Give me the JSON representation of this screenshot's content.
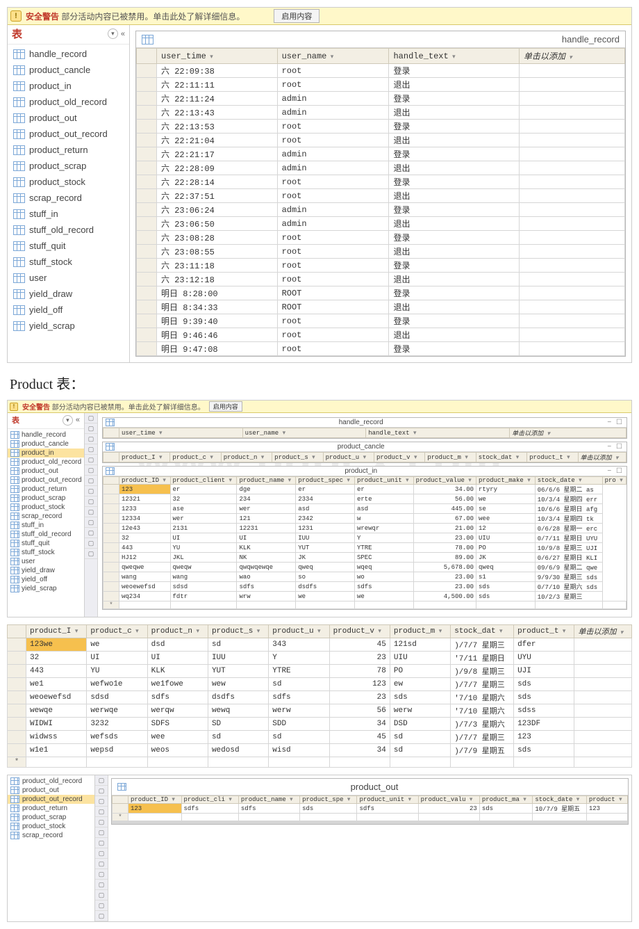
{
  "watermark": "www.bdocx.com",
  "msgbar": {
    "strong": "安全警告",
    "rest": "部分活动内容已被禁用。单击此处了解详细信息。",
    "btn": "启用内容"
  },
  "pane": {
    "title": "表",
    "chevrons": "«",
    "circle": "▾"
  },
  "nav_items": [
    "handle_record",
    "product_cancle",
    "product_in",
    "product_old_record",
    "product_out",
    "product_out_record",
    "product_return",
    "product_scrap",
    "product_stock",
    "scrap_record",
    "stuff_in",
    "stuff_old_record",
    "stuff_quit",
    "stuff_stock",
    "user",
    "yield_draw",
    "yield_off",
    "yield_scrap"
  ],
  "handle_sheet": {
    "title_right": "handle_record",
    "cols": [
      "user_time",
      "user_name",
      "handle_text",
      "单击以添加"
    ],
    "rows": [
      [
        "六 22:09:38",
        "root",
        "登录",
        ""
      ],
      [
        "六 22:11:11",
        "root",
        "退出",
        ""
      ],
      [
        "六 22:11:24",
        "admin",
        "登录",
        ""
      ],
      [
        "六 22:13:43",
        "admin",
        "退出",
        ""
      ],
      [
        "六 22:13:53",
        "root",
        "登录",
        ""
      ],
      [
        "六 22:21:04",
        "root",
        "退出",
        ""
      ],
      [
        "六 22:21:17",
        "admin",
        "登录",
        ""
      ],
      [
        "六 22:28:09",
        "admin",
        "退出",
        ""
      ],
      [
        "六 22:28:14",
        "root",
        "登录",
        ""
      ],
      [
        "六 22:37:51",
        "root",
        "退出",
        ""
      ],
      [
        "六 23:06:24",
        "admin",
        "登录",
        ""
      ],
      [
        "六 23:06:50",
        "admin",
        "退出",
        ""
      ],
      [
        "六 23:08:28",
        "root",
        "登录",
        ""
      ],
      [
        "六 23:08:55",
        "root",
        "退出",
        ""
      ],
      [
        "六 23:11:18",
        "root",
        "登录",
        ""
      ],
      [
        "六 23:12:18",
        "root",
        "退出",
        ""
      ],
      [
        "明日 8:28:00",
        "ROOT",
        "登录",
        ""
      ],
      [
        "明日 8:34:33",
        "ROOT",
        "退出",
        ""
      ],
      [
        "明日 9:39:40",
        "root",
        "登录",
        ""
      ],
      [
        "明日 9:46:46",
        "root",
        "退出",
        ""
      ],
      [
        "明日 9:47:08",
        "root",
        "登录",
        ""
      ]
    ]
  },
  "section_heading": "Product 表：",
  "mini_nav_sel": "product_in",
  "stack": {
    "handle": {
      "title": "handle_record",
      "cols": [
        "user_time",
        "user_name",
        "handle_text",
        "单击以添加"
      ]
    },
    "cancel": {
      "title": "product_cancle",
      "cols": [
        "product_I",
        "product_c",
        "product_n",
        "product_s",
        "product_u",
        "product_v",
        "product_m",
        "stock_dat",
        "product_t",
        "单击以添加"
      ]
    },
    "in": {
      "title": "product_in",
      "cols": [
        "product_ID",
        "product_client",
        "product_name",
        "product_spec",
        "product_unit",
        "product_value",
        "product_make",
        "stock_date",
        "pro"
      ],
      "rows": [
        [
          "123",
          "er",
          "dge",
          "er",
          "er",
          "34.00",
          "rtyry",
          "06/6/6 星期二 as"
        ],
        [
          "12321",
          "32",
          "234",
          "2334",
          "erte",
          "56.00",
          "we",
          "10/3/4 星期四 err"
        ],
        [
          "1233",
          "ase",
          "wer",
          "asd",
          "asd",
          "445.00",
          "se",
          "10/6/6 星期日 afg"
        ],
        [
          "12334",
          "wer",
          "121",
          "2342",
          "w",
          "67.00",
          "wee",
          "10/3/4 星期四 tk"
        ],
        [
          "12e43",
          "2131",
          "12231",
          "1231",
          "wrewqr",
          "21.00",
          "12",
          "0/6/28 星期一 erc"
        ],
        [
          "32",
          "UI",
          "UI",
          "IUU",
          "Y",
          "23.00",
          "UIU",
          "0/7/11 星期日 UYU"
        ],
        [
          "443",
          "YU",
          "KLK",
          "YUT",
          "YTRE",
          "78.00",
          "PO",
          "10/9/8 星期三 UJI"
        ],
        [
          "HJ12",
          "JKL",
          "NK",
          "JK",
          "SPEC",
          "89.00",
          "JK",
          "0/6/27 星期日 KLI"
        ],
        [
          "qweqwe",
          "qweqw",
          "qwqwqewqe",
          "qweq",
          "wqeq",
          "5,678.00",
          "qweq",
          "09/6/9 星期二 qwe"
        ],
        [
          "wang",
          "wang",
          "wao",
          "so",
          "wo",
          "23.00",
          "s1",
          "9/9/30 星期三 sds"
        ],
        [
          "weoewefsd",
          "sdsd",
          "sdfs",
          "dsdfs",
          "sdfs",
          "23.00",
          "sds",
          "0/7/10 星期六 sds"
        ],
        [
          "wq234",
          "fdtr",
          "wrw",
          "we",
          "we",
          "4,500.00",
          "sds",
          "10/2/3 星期三"
        ]
      ]
    }
  },
  "detail": {
    "cols": [
      "product_I",
      "product_c",
      "product_n",
      "product_s",
      "product_u",
      "product_v",
      "product_m",
      "stock_dat",
      "product_t",
      "单击以添加"
    ],
    "rows": [
      [
        "123we",
        "we",
        "dsd",
        "sd",
        "343",
        "45",
        "121sd",
        ")/7/7 星期三",
        "dfer",
        ""
      ],
      [
        "32",
        "UI",
        "UI",
        "IUU",
        "Y",
        "23",
        "UIU",
        "'7/11 星期日",
        "UYU",
        ""
      ],
      [
        "443",
        "YU",
        "KLK",
        "YUT",
        "YTRE",
        "78",
        "PO",
        ")/9/8 星期三",
        "UJI",
        ""
      ],
      [
        "we1",
        "wefwo1e",
        "we1fowe",
        "wew",
        "sd",
        "123",
        "ew",
        ")/7/7 星期三",
        "sds",
        ""
      ],
      [
        "weoewefsd",
        "sdsd",
        "sdfs",
        "dsdfs",
        "sdfs",
        "23",
        "sds",
        "'7/10 星期六",
        "sds",
        ""
      ],
      [
        "wewqe",
        "werwqe",
        "werqw",
        "wewq",
        "werw",
        "56",
        "werw",
        "'7/10 星期六",
        "sdss",
        ""
      ],
      [
        "WIDWI",
        "3232",
        "SDFS",
        "SD",
        "SDD",
        "34",
        "DSD",
        ")/7/3 星期六",
        "123DF",
        ""
      ],
      [
        "widwss",
        "wefsds",
        "wee",
        "sd",
        "sd",
        "45",
        "sd",
        ")/7/7 星期三",
        "123",
        ""
      ],
      [
        "w1e1",
        "wepsd",
        "weos",
        "wedosd",
        "wisd",
        "34",
        "sd",
        ")/7/9 星期五",
        "sds",
        ""
      ]
    ],
    "star": "*"
  },
  "out_nav": [
    "product_old_record",
    "product_out",
    "product_out_record",
    "product_return",
    "product_scrap",
    "product_stock",
    "scrap_record"
  ],
  "out_nav_sel": "product_out_record",
  "out_sheet": {
    "title": "product_out",
    "cols": [
      "product_ID",
      "product_cli",
      "product_name",
      "product_spe",
      "product_unit",
      "product_valu",
      "product_ma",
      "stock_date",
      "product"
    ],
    "rows": [
      [
        "123",
        "sdfs",
        "sdfs",
        "sds",
        "sdfs",
        "23",
        "sds",
        "10/7/9 星期五",
        "123"
      ]
    ]
  },
  "winctrl": "−  ☐"
}
